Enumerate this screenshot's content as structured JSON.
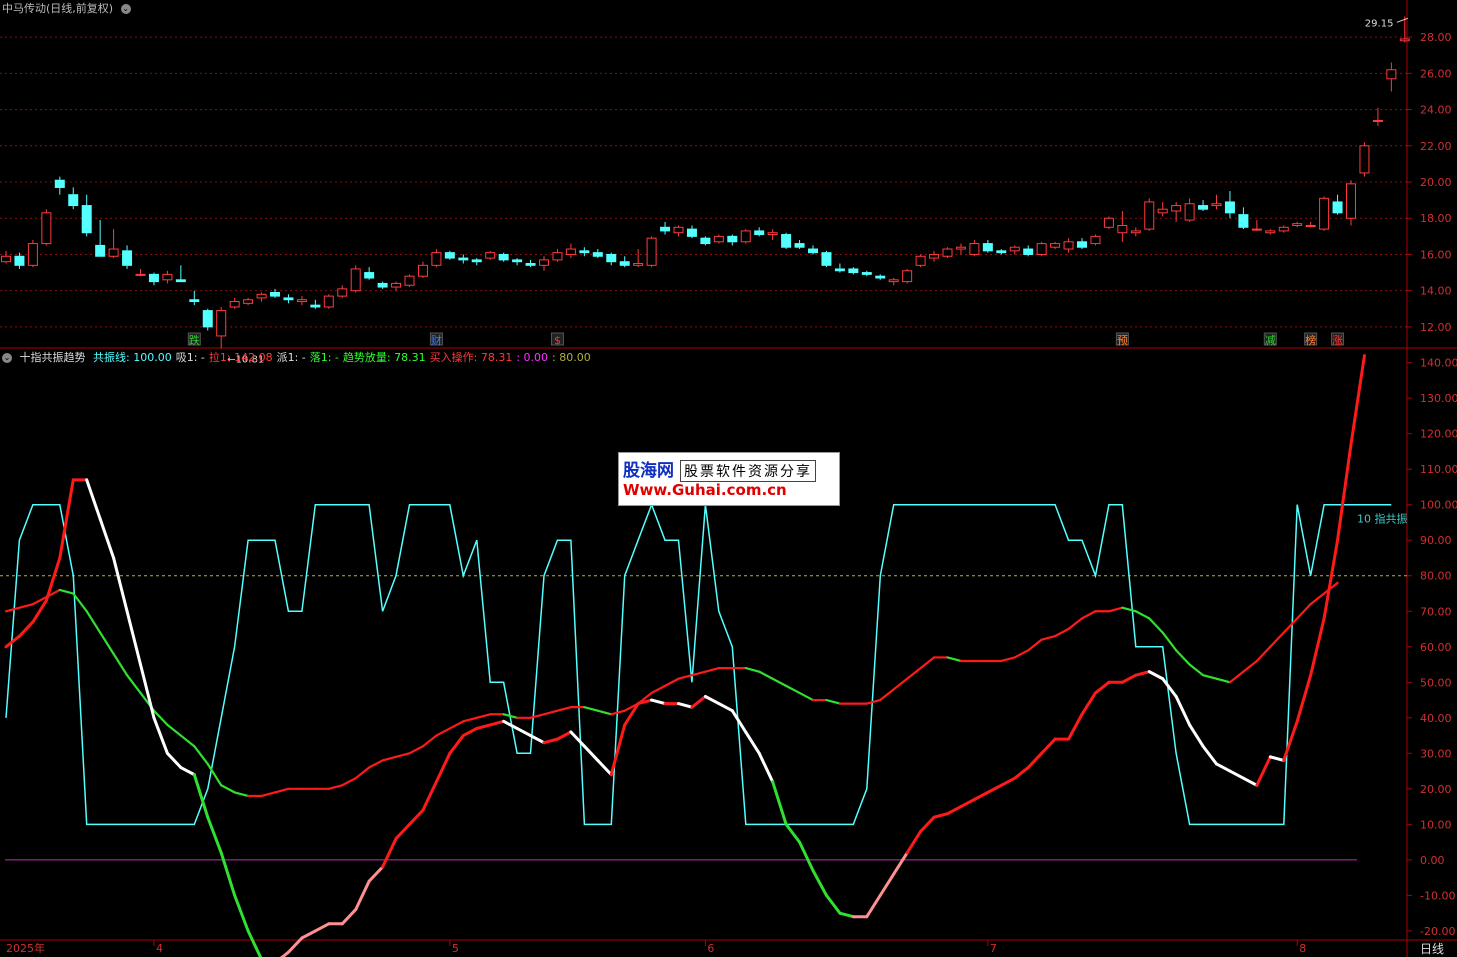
{
  "price_chart": {
    "title": "中马传动(日线,前复权)",
    "y_ticks": [
      "28.00",
      "26.00",
      "24.00",
      "22.00",
      "20.00",
      "18.00",
      "16.00",
      "14.00",
      "12.00"
    ],
    "high_label": "29.15",
    "low_label": "10.81",
    "event_markers": [
      {
        "label": "跌",
        "color": "#30d030"
      },
      {
        "label": "财",
        "color": "#3080ff"
      },
      {
        "label": "$",
        "color": "#ff3030"
      },
      {
        "label": "预",
        "color": "#ff8030"
      },
      {
        "label": "减",
        "color": "#30d030"
      },
      {
        "label": "榜",
        "color": "#ff8030"
      },
      {
        "label": "涨",
        "color": "#ff3030"
      }
    ],
    "colors": {
      "up": "#ff3b3b",
      "down": "#54ffff"
    }
  },
  "indicator": {
    "name": "十指共振趋势",
    "fields": [
      {
        "label": "共振线: 100.00",
        "color": "#54ffff"
      },
      {
        "label": "吸1: -",
        "color": "#dddddd"
      },
      {
        "label": "拉1: 142.08",
        "color": "#ff3b3b"
      },
      {
        "label": "派1: -",
        "color": "#dddddd"
      },
      {
        "label": "落1: -",
        "color": "#30ff30"
      },
      {
        "label": "趋势放量: 78.31",
        "color": "#30ff30"
      },
      {
        "label": "买入操作: 78.31",
        "color": "#ff3b3b"
      },
      {
        "label": ": 0.00",
        "color": "#ff30ff"
      },
      {
        "label": ": 80.00",
        "color": "#b0b040"
      }
    ],
    "y_ticks": [
      "140.00",
      "130.00",
      "120.00",
      "110.00",
      "100.00",
      "90.00",
      "80.00",
      "70.00",
      "60.00",
      "50.00",
      "40.00",
      "30.00",
      "20.00",
      "10.00",
      "0.00",
      "-10.00",
      "-20.00"
    ],
    "right_label": "10 指共振"
  },
  "x_axis": {
    "labels": [
      "2025年",
      "4",
      "5",
      "6",
      "7",
      "8"
    ],
    "period_label": "日线"
  },
  "watermark": {
    "site": "股海网",
    "tagline": "股票软件资源分享",
    "url": "Www.Guhai.com.cn"
  },
  "chart_data": [
    {
      "type": "candlestick",
      "title": "中马传动(日线,前复权)",
      "ylim": [
        11,
        29.5
      ],
      "series": [
        {
          "name": "candles",
          "ohlc": [
            [
              15.6,
              16.2,
              15.5,
              15.9
            ],
            [
              15.9,
              16.1,
              15.2,
              15.4
            ],
            [
              15.4,
              16.8,
              15.3,
              16.6
            ],
            [
              16.6,
              18.5,
              16.5,
              18.3
            ],
            [
              20.1,
              20.3,
              19.3,
              19.7
            ],
            [
              19.3,
              19.7,
              18.5,
              18.7
            ],
            [
              18.7,
              19.3,
              17.0,
              17.2
            ],
            [
              16.5,
              17.9,
              15.9,
              15.9
            ],
            [
              15.9,
              17.4,
              15.8,
              16.3
            ],
            [
              16.2,
              16.5,
              15.2,
              15.4
            ],
            [
              14.9,
              15.2,
              14.8,
              14.9
            ],
            [
              14.9,
              15.0,
              14.3,
              14.5
            ],
            [
              14.6,
              15.1,
              14.4,
              14.9
            ],
            [
              14.6,
              15.4,
              14.5,
              14.5
            ],
            [
              13.5,
              14.0,
              13.2,
              13.4
            ],
            [
              12.9,
              13.0,
              11.8,
              12.0
            ],
            [
              11.5,
              13.1,
              10.81,
              12.9
            ],
            [
              13.1,
              13.6,
              13.0,
              13.4
            ],
            [
              13.3,
              13.6,
              13.2,
              13.5
            ],
            [
              13.6,
              13.9,
              13.4,
              13.8
            ],
            [
              13.9,
              14.1,
              13.6,
              13.7
            ],
            [
              13.6,
              13.8,
              13.3,
              13.5
            ],
            [
              13.4,
              13.7,
              13.2,
              13.5
            ],
            [
              13.2,
              13.5,
              13.0,
              13.1
            ],
            [
              13.1,
              13.8,
              13.0,
              13.7
            ],
            [
              13.7,
              14.3,
              13.6,
              14.1
            ],
            [
              14.0,
              15.4,
              13.9,
              15.2
            ],
            [
              15.0,
              15.3,
              14.6,
              14.7
            ],
            [
              14.4,
              14.5,
              14.1,
              14.2
            ],
            [
              14.2,
              14.5,
              14.0,
              14.4
            ],
            [
              14.3,
              14.9,
              14.2,
              14.8
            ],
            [
              14.8,
              15.6,
              14.7,
              15.4
            ],
            [
              15.4,
              16.3,
              15.3,
              16.1
            ],
            [
              16.1,
              16.2,
              15.7,
              15.8
            ],
            [
              15.8,
              16.0,
              15.5,
              15.7
            ],
            [
              15.7,
              15.8,
              15.4,
              15.6
            ],
            [
              15.8,
              16.2,
              15.7,
              16.1
            ],
            [
              16.0,
              16.1,
              15.6,
              15.7
            ],
            [
              15.7,
              15.8,
              15.4,
              15.6
            ],
            [
              15.5,
              15.7,
              15.3,
              15.4
            ],
            [
              15.4,
              15.9,
              15.1,
              15.7
            ],
            [
              15.7,
              16.3,
              15.6,
              16.1
            ],
            [
              16.0,
              16.6,
              15.8,
              16.3
            ],
            [
              16.2,
              16.4,
              15.9,
              16.1
            ],
            [
              16.1,
              16.3,
              15.8,
              15.9
            ],
            [
              16.0,
              16.1,
              15.4,
              15.6
            ],
            [
              15.6,
              15.9,
              15.3,
              15.4
            ],
            [
              15.4,
              16.3,
              15.3,
              15.5
            ],
            [
              15.4,
              17.0,
              15.3,
              16.9
            ],
            [
              17.5,
              17.8,
              17.1,
              17.3
            ],
            [
              17.2,
              17.6,
              17.0,
              17.5
            ],
            [
              17.4,
              17.6,
              16.9,
              17.0
            ],
            [
              16.9,
              17.0,
              16.5,
              16.6
            ],
            [
              16.7,
              17.1,
              16.6,
              17.0
            ],
            [
              17.0,
              17.1,
              16.5,
              16.7
            ],
            [
              16.7,
              17.4,
              16.6,
              17.3
            ],
            [
              17.3,
              17.5,
              17.0,
              17.1
            ],
            [
              17.1,
              17.4,
              16.8,
              17.2
            ],
            [
              17.1,
              17.2,
              16.3,
              16.4
            ],
            [
              16.6,
              16.8,
              16.3,
              16.4
            ],
            [
              16.3,
              16.5,
              16.0,
              16.1
            ],
            [
              16.1,
              16.2,
              15.3,
              15.4
            ],
            [
              15.2,
              15.5,
              15.0,
              15.1
            ],
            [
              15.2,
              15.3,
              14.9,
              15.0
            ],
            [
              15.0,
              15.1,
              14.8,
              14.9
            ],
            [
              14.8,
              14.9,
              14.6,
              14.7
            ],
            [
              14.5,
              14.7,
              14.3,
              14.6
            ],
            [
              14.5,
              15.2,
              14.4,
              15.1
            ],
            [
              15.4,
              16.0,
              15.3,
              15.9
            ],
            [
              15.8,
              16.2,
              15.6,
              16.0
            ],
            [
              15.9,
              16.4,
              15.8,
              16.3
            ],
            [
              16.3,
              16.6,
              16.0,
              16.4
            ],
            [
              16.0,
              16.8,
              15.9,
              16.6
            ],
            [
              16.6,
              16.8,
              16.1,
              16.2
            ],
            [
              16.2,
              16.3,
              16.0,
              16.1
            ],
            [
              16.2,
              16.5,
              16.0,
              16.4
            ],
            [
              16.3,
              16.5,
              15.9,
              16.0
            ],
            [
              16.0,
              16.7,
              15.9,
              16.6
            ],
            [
              16.4,
              16.7,
              16.3,
              16.6
            ],
            [
              16.3,
              16.9,
              16.1,
              16.7
            ],
            [
              16.7,
              16.9,
              16.3,
              16.4
            ],
            [
              16.6,
              17.1,
              16.5,
              17.0
            ],
            [
              17.5,
              18.1,
              17.4,
              18.0
            ],
            [
              17.2,
              18.4,
              16.7,
              17.6
            ],
            [
              17.2,
              17.5,
              17.0,
              17.3
            ],
            [
              17.4,
              19.1,
              17.3,
              18.9
            ],
            [
              18.3,
              18.9,
              18.1,
              18.5
            ],
            [
              18.4,
              18.9,
              17.8,
              18.7
            ],
            [
              17.9,
              19.1,
              17.8,
              18.8
            ],
            [
              18.7,
              19.0,
              18.4,
              18.5
            ],
            [
              18.7,
              19.3,
              18.5,
              18.8
            ],
            [
              18.9,
              19.5,
              18.0,
              18.3
            ],
            [
              18.2,
              18.6,
              17.4,
              17.5
            ],
            [
              17.4,
              17.9,
              17.3,
              17.4
            ],
            [
              17.2,
              17.4,
              17.1,
              17.3
            ],
            [
              17.3,
              17.6,
              17.2,
              17.5
            ],
            [
              17.6,
              17.8,
              17.5,
              17.7
            ],
            [
              17.6,
              17.8,
              17.5,
              17.6
            ],
            [
              17.4,
              19.2,
              17.3,
              19.1
            ],
            [
              18.9,
              19.3,
              18.2,
              18.3
            ],
            [
              18.0,
              20.1,
              17.6,
              19.9
            ],
            [
              20.5,
              22.2,
              20.3,
              22.0
            ],
            [
              23.4,
              24.1,
              23.1,
              23.4
            ],
            [
              25.7,
              26.6,
              25.0,
              26.2
            ],
            [
              27.8,
              29.15,
              27.7,
              27.9
            ]
          ]
        }
      ]
    },
    {
      "type": "line",
      "title": "十指共振趋势",
      "ylim": [
        -22,
        143
      ],
      "series": [
        {
          "name": "共振线",
          "color": "#54ffff",
          "values": [
            40,
            90,
            100,
            100,
            100,
            80,
            10,
            10,
            10,
            10,
            10,
            10,
            10,
            10,
            10,
            20,
            40,
            60,
            90,
            90,
            90,
            70,
            70,
            100,
            100,
            100,
            100,
            100,
            70,
            80,
            100,
            100,
            100,
            100,
            80,
            90,
            50,
            50,
            30,
            30,
            80,
            90,
            90,
            10,
            10,
            10,
            80,
            90,
            100,
            90,
            90,
            50,
            100,
            70,
            60,
            10,
            10,
            10,
            10,
            10,
            10,
            10,
            10,
            10,
            20,
            80,
            100,
            100,
            100,
            100,
            100,
            100,
            100,
            100,
            100,
            100,
            100,
            100,
            100,
            90,
            90,
            80,
            100,
            100,
            60,
            60,
            60,
            30,
            10,
            10,
            10,
            10,
            10,
            10,
            10,
            10,
            100,
            80,
            100,
            100,
            100,
            100,
            100,
            100
          ]
        },
        {
          "name": "基线",
          "color": "#c06040",
          "values": [
            70,
            71,
            72,
            74,
            76,
            75,
            70,
            64,
            58,
            52,
            47,
            42,
            38,
            35,
            32,
            27,
            21,
            19,
            18,
            18,
            19,
            20,
            20,
            20,
            20,
            21,
            23,
            26,
            28,
            29,
            30,
            32,
            35,
            37,
            39,
            40,
            41,
            41,
            40,
            40,
            41,
            42,
            43,
            43,
            42,
            41,
            42,
            44,
            47,
            49,
            51,
            52,
            53,
            54,
            54,
            54,
            53,
            51,
            49,
            47,
            45,
            45,
            44,
            44,
            44,
            45,
            48,
            51,
            54,
            57,
            57,
            56,
            56,
            56,
            56,
            57,
            59,
            62,
            63,
            65,
            68,
            70,
            70,
            71,
            70,
            68,
            64,
            59,
            55,
            52,
            51,
            50,
            53,
            56,
            60,
            64,
            68,
            72,
            75,
            78
          ]
        },
        {
          "name": "操作线",
          "color": "#ffffff",
          "values": [
            60,
            63,
            67,
            73,
            85,
            107,
            107,
            96,
            85,
            70,
            55,
            40,
            30,
            26,
            24,
            12,
            2,
            -10,
            -20,
            -28,
            -29,
            -26,
            -22,
            -20,
            -18,
            -18,
            -14,
            -6,
            -2,
            6,
            10,
            14,
            22,
            30,
            35,
            37,
            38,
            39,
            37,
            35,
            33,
            34,
            36,
            32,
            28,
            24,
            38,
            44,
            45,
            44,
            44,
            43,
            46,
            44,
            42,
            36,
            30,
            22,
            10,
            5,
            -3,
            -10,
            -15,
            -16,
            -16,
            -10,
            -4,
            2,
            8,
            12,
            13,
            15,
            17,
            19,
            21,
            23,
            26,
            30,
            34,
            34,
            41,
            47,
            50,
            50,
            52,
            53,
            51,
            46,
            38,
            32,
            27,
            25,
            23,
            21,
            29,
            28,
            39,
            52,
            68,
            90,
            117,
            142
          ]
        }
      ]
    }
  ]
}
